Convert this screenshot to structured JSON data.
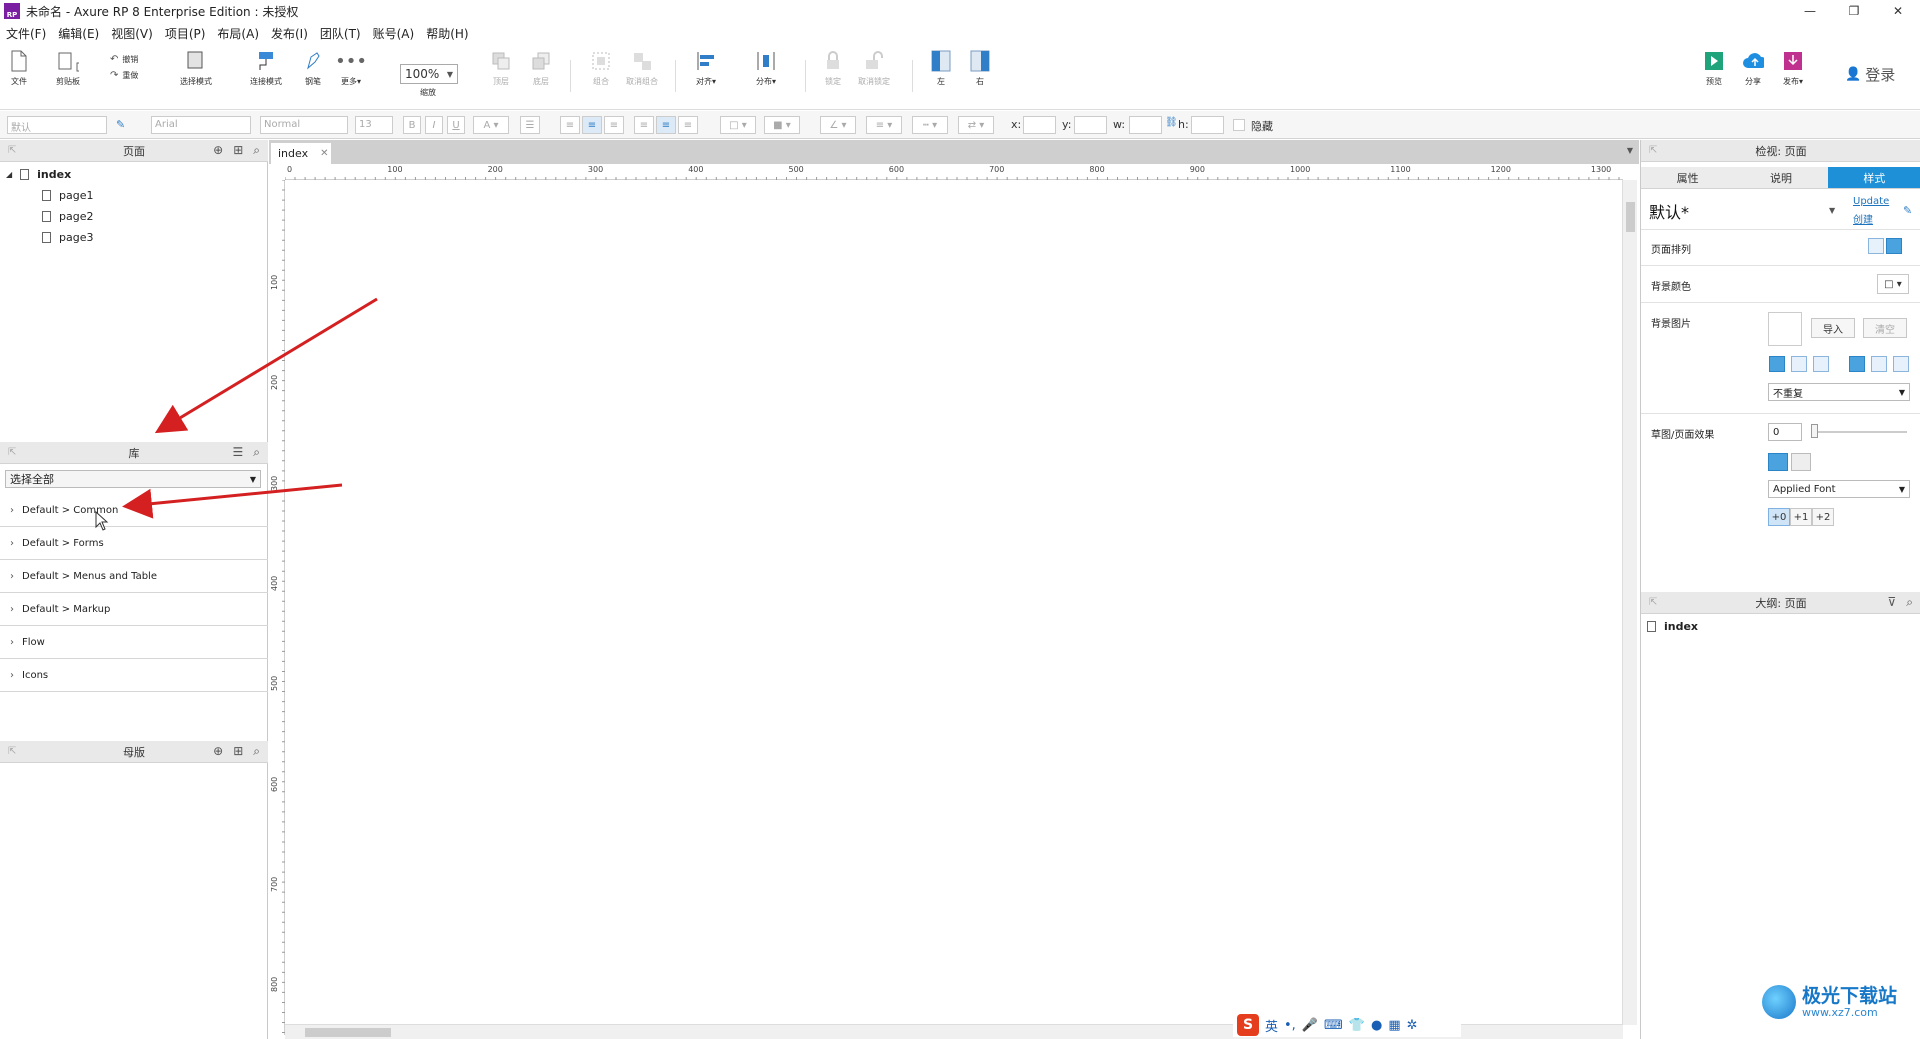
{
  "window": {
    "title": "未命名 - Axure RP 8 Enterprise Edition : 未授权",
    "logo_text": "RP"
  },
  "menu": [
    "文件(F)",
    "编辑(E)",
    "视图(V)",
    "项目(P)",
    "布局(A)",
    "发布(I)",
    "团队(T)",
    "账号(A)",
    "帮助(H)"
  ],
  "toolbar": {
    "file": "文件",
    "clipboard": "剪贴板",
    "undo": "撤销",
    "redo": "重做",
    "select_mode": "选择模式",
    "connect_mode": "连接模式",
    "pen": "钢笔",
    "more": "更多▾",
    "zoom_value": "100%",
    "zoom_label": "缩放",
    "top": "顶层",
    "bottom": "底层",
    "group": "组合",
    "ungroup": "取消组合",
    "align": "对齐▾",
    "distribute": "分布▾",
    "lock": "锁定",
    "unlock": "取消锁定",
    "left": "左",
    "right": "右",
    "preview": "预览",
    "share": "分享",
    "publish": "发布▾",
    "login": "登录"
  },
  "formatbar": {
    "style": "默认",
    "font": "Arial",
    "weight": "Normal",
    "size": "13",
    "x_label": "x:",
    "y_label": "y:",
    "w_label": "w:",
    "h_label": "h:",
    "hidden_label": "隐藏"
  },
  "pages_panel": {
    "title": "页面",
    "root": "index",
    "children": [
      "page1",
      "page2",
      "page3"
    ]
  },
  "library_panel": {
    "title": "库",
    "selected": "选择全部",
    "items": [
      "Default > Common",
      "Default > Forms",
      "Default > Menus and Table",
      "Default > Markup",
      "Flow",
      "Icons"
    ]
  },
  "masters_panel": {
    "title": "母版"
  },
  "canvas": {
    "tab": "index",
    "ruler_h": [
      "0",
      "100",
      "200",
      "300",
      "400",
      "500",
      "600",
      "700",
      "800",
      "900",
      "1000",
      "1100",
      "1200",
      "1300"
    ],
    "ruler_v": [
      "100",
      "200",
      "300",
      "400",
      "500",
      "600",
      "700",
      "800"
    ]
  },
  "inspector": {
    "title": "检视: 页面",
    "tabs": [
      "属性",
      "说明",
      "样式"
    ],
    "style_name": "默认*",
    "update_link": "Update",
    "create_link": "创建",
    "page_align_label": "页面排列",
    "bg_color_label": "背景颜色",
    "bg_image_label": "背景图片",
    "import_btn": "导入",
    "clear_btn": "清空",
    "repeat_value": "不重复",
    "sketch_label": "草图/页面效果",
    "sketch_value": "0",
    "font_value": "Applied Font",
    "font_deltas": [
      "+0",
      "+1",
      "+2"
    ]
  },
  "outline_panel": {
    "title": "大纲: 页面",
    "root": "index"
  },
  "ime": {
    "logo": "S",
    "lang": "英",
    "punct": "•,"
  },
  "watermark": {
    "name": "极光下载站",
    "url": "www.xz7.com"
  },
  "colors": {
    "accent": "#1e90d8",
    "arrow": "#d42020",
    "logo": "#7a1fa2"
  }
}
